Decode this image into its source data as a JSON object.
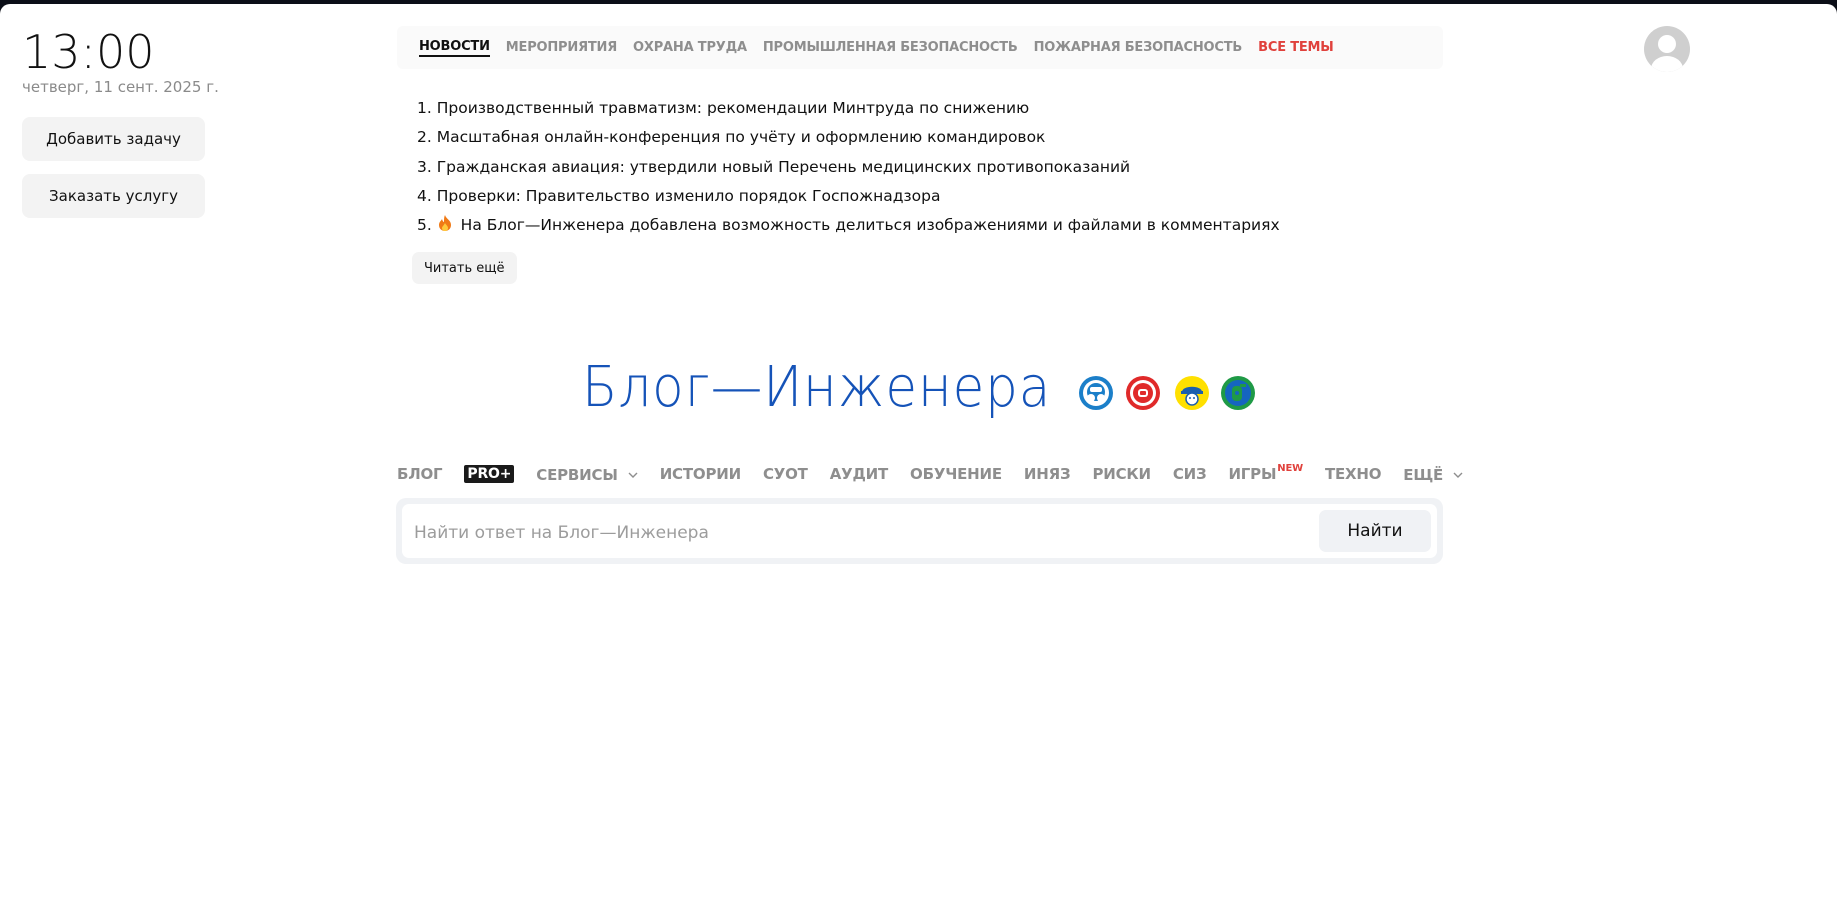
{
  "sidebar": {
    "time": "13:00",
    "date": "четверг, 11 сент. 2025 г.",
    "add_task_label": "Добавить задачу",
    "order_service_label": "Заказать услугу"
  },
  "topics": {
    "tabs": [
      {
        "label": "НОВОСТИ",
        "active": true
      },
      {
        "label": "МЕРОПРИЯТИЯ"
      },
      {
        "label": "ОХРАНА ТРУДА"
      },
      {
        "label": "ПРОМЫШЛЕННАЯ БЕЗОПАСНОСТЬ"
      },
      {
        "label": "ПОЖАРНАЯ БЕЗОПАСНОСТЬ"
      },
      {
        "label": "ВСЕ ТЕМЫ",
        "color": "#e0413c"
      }
    ]
  },
  "news": {
    "items": [
      "1. Производственный травматизм: рекомендации Минтруда по снижению",
      "2. Масштабная онлайн-конференция по учёту и оформлению командировок",
      "3. Гражданская авиация: утвердили новый Перечень медицинских противопоказаний",
      "4. Проверки: Правительство изменило порядок Госпожнадзора",
      "На Блог—Инженера добавлена возможность делиться изображениями и файлами в комментариях"
    ],
    "item5_prefix": "5.",
    "item5_icon": "fire-icon",
    "read_more_label": "Читать ещё"
  },
  "logo": {
    "text": "Блог—Инженера",
    "color": "#1553b8",
    "badges": [
      "respirator-icon",
      "fire-helmet-icon",
      "hardhat-icon",
      "fire-extinguisher-icon"
    ]
  },
  "nav": {
    "blog": "БЛОГ",
    "pro": "PRO+",
    "services": "СЕРВИСЫ",
    "stories": "ИСТОРИИ",
    "suot": "СУОТ",
    "audit": "АУДИТ",
    "education": "ОБУЧЕНИЕ",
    "inyaz": "ИНЯЗ",
    "risks": "РИСКИ",
    "siz": "СИЗ",
    "games": "ИГРЫ",
    "games_badge": "NEW",
    "techno": "ТЕХНО",
    "more": "ЕЩЁ"
  },
  "search": {
    "placeholder": "Найти ответ на Блог—Инженера",
    "button_label": "Найти"
  }
}
